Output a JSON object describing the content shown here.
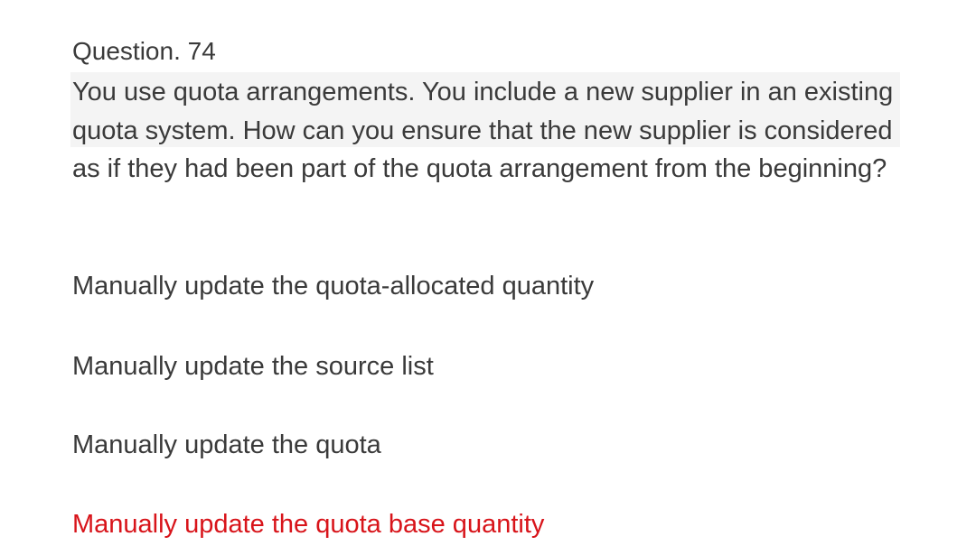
{
  "question": {
    "number_label": "Question. 74",
    "text": "You use quota arrangements. You include a new supplier in an existing quota system. How can you ensure that the new supplier is considered as if they had been part of the quota arrangement from the beginning?"
  },
  "options": [
    {
      "label": "Manually update the quota-allocated quantity",
      "correct": false
    },
    {
      "label": "Manually update the source list",
      "correct": false
    },
    {
      "label": "Manually update the quota",
      "correct": false
    },
    {
      "label": "Manually update the quota base quantity",
      "correct": true
    }
  ],
  "colors": {
    "text": "#3a3a3a",
    "correct_answer": "#d8141a",
    "highlight_band": "#f4f4f4"
  }
}
